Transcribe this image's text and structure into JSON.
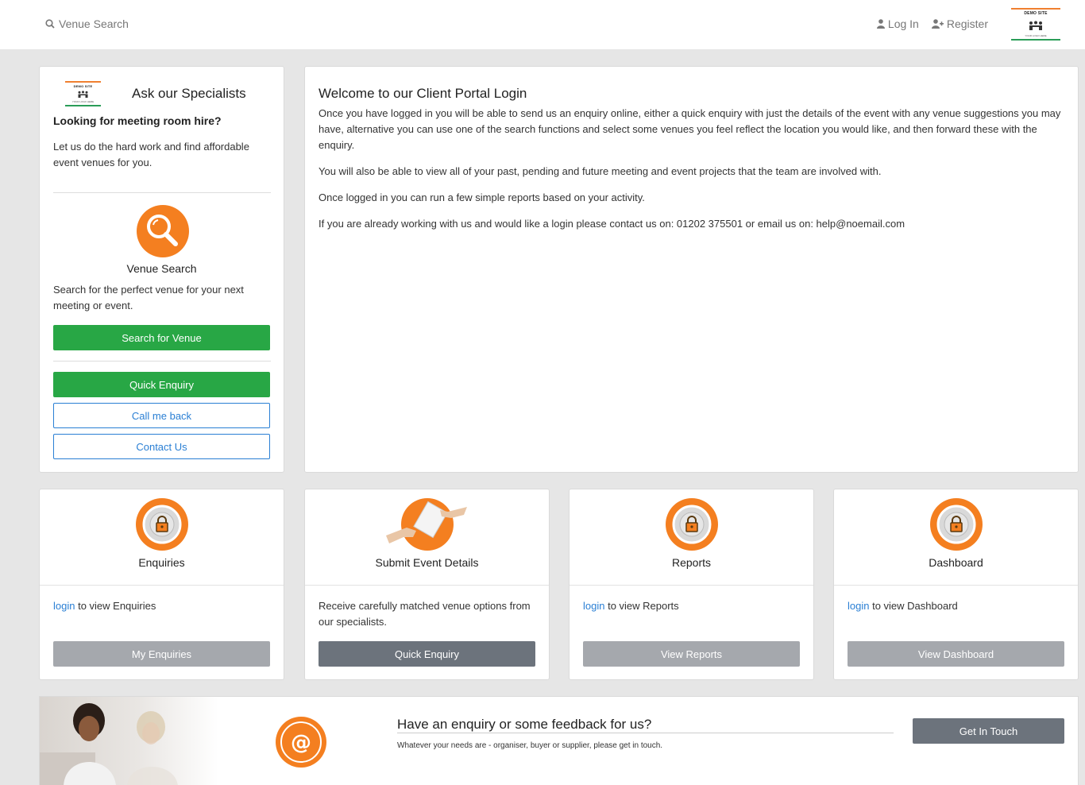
{
  "nav": {
    "search_label": "Venue Search",
    "login_label": "Log In",
    "register_label": "Register",
    "logo_text": "DEMO SITE",
    "logo_subtext": "YOUR LOGO HERE"
  },
  "specialists": {
    "heading": "Ask our Specialists",
    "subheading": "Looking for meeting room hire?",
    "intro": "Let us do the hard work and find affordable event venues for you.",
    "venue_search_label": "Venue Search",
    "venue_search_text": "Search for the perfect venue for your next meeting or event.",
    "search_button": "Search for Venue",
    "quick_enquiry_button": "Quick Enquiry",
    "call_back_button": "Call me back",
    "contact_button": "Contact Us"
  },
  "welcome": {
    "title": "Welcome to our Client Portal Login",
    "p1": "Once you have logged in you will be able to send us an enquiry online, either a quick enquiry with just the details of the event with any venue suggestions you may have, alternative you can use one of the search functions and select some venues you feel reflect the location you would like, and then forward these with the enquiry.",
    "p2": "You will also be able to view all of your past, pending and future meeting and event projects that the team are involved with.",
    "p3": "Once logged in you can run a few simple reports based on your activity.",
    "p4": "If you are already working with us and would like a login please contact us on: 01202 375501 or email us on: help@noemail.com"
  },
  "cards": [
    {
      "title": "Enquiries",
      "link": "login",
      "text": " to view Enquiries",
      "button": "My Enquiries",
      "icon": "lock-icon"
    },
    {
      "title": "Submit Event Details",
      "text": "Receive carefully matched venue options from our specialists.",
      "button": "Quick Enquiry",
      "icon": "handshake-document-icon"
    },
    {
      "title": "Reports",
      "link": "login",
      "text": " to view Reports",
      "button": "View Reports",
      "icon": "lock-icon"
    },
    {
      "title": "Dashboard",
      "link": "login",
      "text": " to view Dashboard",
      "button": "View Dashboard",
      "icon": "lock-icon"
    }
  ],
  "feedback": {
    "title": "Have an enquiry or some feedback for us?",
    "subtitle": "Whatever your needs are - organiser, buyer or supplier, please get in touch.",
    "button": "Get In Touch"
  },
  "colors": {
    "accent_orange": "#f47f20",
    "green": "#28a745",
    "link_blue": "#2a7fd4",
    "panel_bg": "#ffffff",
    "page_bg": "#e6e6e6"
  }
}
